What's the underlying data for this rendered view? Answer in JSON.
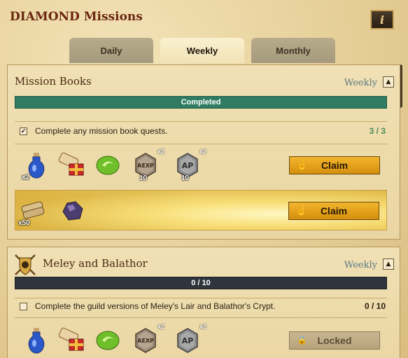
{
  "header": {
    "title": "DIAMOND Missions",
    "info_label": "i"
  },
  "tabs": [
    {
      "label": "Daily",
      "active": false
    },
    {
      "label": "Weekly",
      "active": true
    },
    {
      "label": "Monthly",
      "active": false
    }
  ],
  "missions": [
    {
      "title": "Mission Books",
      "period": "Weekly",
      "progress_label": "Completed",
      "progress_state": "completed",
      "quest": {
        "text": "Complete any mission book quests.",
        "count": "3 / 3",
        "checked": true
      },
      "rewards_row1": [
        {
          "icon": "potion-icon",
          "mult": "x2"
        },
        {
          "icon": "scroll-gift-icon"
        },
        {
          "icon": "green-gem-icon"
        },
        {
          "icon": "aexp-coin-icon",
          "badge": "x2",
          "level": "10"
        },
        {
          "icon": "ap-coin-icon",
          "badge": "x2",
          "level": "10"
        }
      ],
      "claim_label": "Claim",
      "rewards_row2": [
        {
          "icon": "scroll-stack-icon",
          "mult": "x50"
        },
        {
          "icon": "dark-ore-icon"
        }
      ],
      "claim2_label": "Claim"
    },
    {
      "title": "Meley and Balathor",
      "period": "Weekly",
      "progress_label": "0 / 10",
      "progress_state": "in-progress",
      "quest": {
        "text": "Complete the guild versions of Meley's Lair and Balathor's Crypt.",
        "count": "0 / 10",
        "checked": false
      },
      "rewards_row1": [
        {
          "icon": "potion-icon"
        },
        {
          "icon": "scroll-gift-icon"
        },
        {
          "icon": "green-gem-icon"
        },
        {
          "icon": "aexp-coin-icon",
          "badge": "x2"
        },
        {
          "icon": "ap-coin-icon",
          "badge": "x2"
        }
      ],
      "locked_label": "Locked"
    }
  ],
  "colors": {
    "completed_bar": "#2f7c63",
    "empty_bar": "#2f353d",
    "claim_button": "#e7a21c",
    "period_text": "#5c7a86"
  },
  "icons": {
    "check": "✔",
    "collapse": "▲",
    "hand": "☝",
    "lock": "🔒"
  }
}
